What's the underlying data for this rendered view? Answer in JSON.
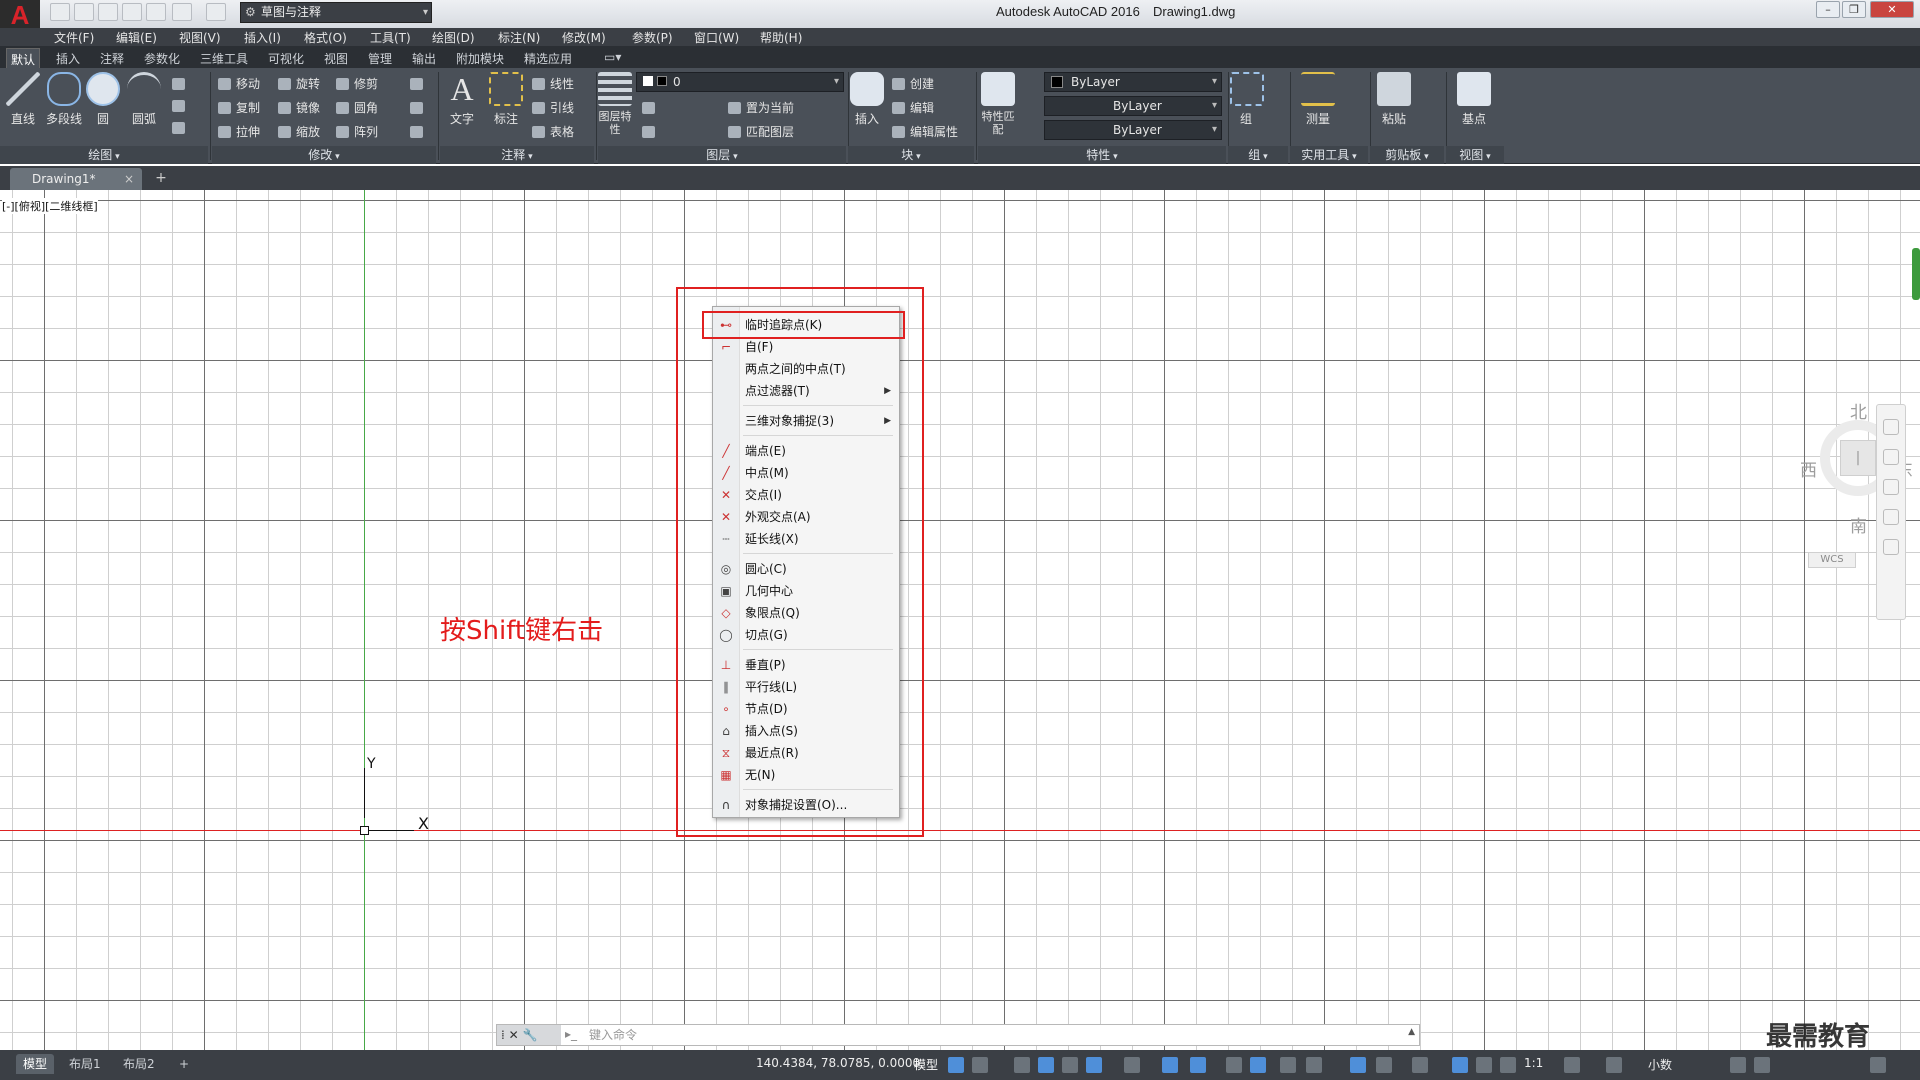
{
  "app": {
    "title": "Autodesk AutoCAD 2016",
    "document": "Drawing1.dwg",
    "logo_letter": "A"
  },
  "quick_access": {
    "workspace": "草图与注释"
  },
  "menubar": [
    "文件(F)",
    "编辑(E)",
    "视图(V)",
    "插入(I)",
    "格式(O)",
    "工具(T)",
    "绘图(D)",
    "标注(N)",
    "修改(M)",
    "参数(P)",
    "窗口(W)",
    "帮助(H)"
  ],
  "ribbon_tabs": [
    "默认",
    "插入",
    "注释",
    "参数化",
    "三维工具",
    "可视化",
    "视图",
    "管理",
    "输出",
    "附加模块",
    "精选应用"
  ],
  "ribbon": {
    "draw": {
      "title": "绘图",
      "buttons": [
        "直线",
        "多段线",
        "圆",
        "圆弧"
      ]
    },
    "modify": {
      "title": "修改",
      "buttons": [
        "移动",
        "旋转",
        "修剪",
        "复制",
        "镜像",
        "圆角",
        "拉伸",
        "缩放",
        "阵列"
      ]
    },
    "annotation": {
      "title": "注释",
      "buttons": [
        "文字",
        "标注",
        "线性",
        "引线",
        "表格"
      ]
    },
    "layers": {
      "title": "图层",
      "big": "图层特性",
      "layer_value": "0",
      "buttons": [
        "置为当前",
        "匹配图层"
      ]
    },
    "block": {
      "title": "块",
      "big": "插入",
      "buttons": [
        "创建",
        "编辑",
        "编辑属性"
      ]
    },
    "properties": {
      "title": "特性",
      "big": "特性匹配",
      "values": [
        "ByLayer",
        "ByLayer",
        "ByLayer"
      ]
    },
    "groups": {
      "title": "组",
      "big": "组"
    },
    "utilities": {
      "title": "实用工具",
      "big": "测量"
    },
    "clipboard": {
      "title": "剪贴板",
      "big": "粘贴"
    },
    "view": {
      "title": "视图",
      "big": "基点"
    }
  },
  "doc_tab": {
    "label": "Drawing1*",
    "close": "×",
    "add": "+"
  },
  "viewport": {
    "label": "[-][俯视][二维线框]",
    "ucs_y": "Y",
    "ucs_x": "X"
  },
  "annotation_text": "按Shift键右击",
  "context_menu": {
    "items": [
      {
        "label": "临时追踪点(K)",
        "icon": "tracking-icon"
      },
      {
        "label": "自(F)",
        "icon": "from-icon"
      },
      {
        "label": "两点之间的中点(T)",
        "icon": ""
      },
      {
        "label": "点过滤器(T)",
        "icon": "",
        "submenu": true
      },
      {
        "label": "三维对象捕捉(3)",
        "icon": "",
        "submenu": true
      },
      {
        "label": "端点(E)",
        "icon": "endpoint-icon"
      },
      {
        "label": "中点(M)",
        "icon": "midpoint-icon"
      },
      {
        "label": "交点(I)",
        "icon": "intersection-icon"
      },
      {
        "label": "外观交点(A)",
        "icon": "apparent-intersection-icon"
      },
      {
        "label": "延长线(X)",
        "icon": "extension-icon"
      },
      {
        "label": "圆心(C)",
        "icon": "center-icon"
      },
      {
        "label": "几何中心",
        "icon": "geometric-center-icon"
      },
      {
        "label": "象限点(Q)",
        "icon": "quadrant-icon"
      },
      {
        "label": "切点(G)",
        "icon": "tangent-icon"
      },
      {
        "label": "垂直(P)",
        "icon": "perpendicular-icon"
      },
      {
        "label": "平行线(L)",
        "icon": "parallel-icon"
      },
      {
        "label": "节点(D)",
        "icon": "node-icon"
      },
      {
        "label": "插入点(S)",
        "icon": "insertion-icon"
      },
      {
        "label": "最近点(R)",
        "icon": "nearest-icon"
      },
      {
        "label": "无(N)",
        "icon": "none-icon"
      },
      {
        "label": "对象捕捉设置(O)...",
        "icon": "osnap-settings-icon"
      }
    ]
  },
  "viewcube": {
    "north": "北",
    "west": "西",
    "east": "东",
    "south": "南",
    "wcs": "WCS"
  },
  "command_line": {
    "placeholder": "键入命令"
  },
  "status": {
    "layouts": [
      "模型",
      "布局1",
      "布局2"
    ],
    "add": "+",
    "coords": "140.4384, 78.0785, 0.0000",
    "model": "模型",
    "scale": "1:1",
    "units": "小数"
  },
  "watermark": "最需教育",
  "colors": {
    "highlight": "#e02020",
    "ribbon_bg": "#4a5058",
    "menubar_bg": "#3b3f45",
    "x_axis": "#dd2222",
    "y_axis": "#48a848"
  }
}
